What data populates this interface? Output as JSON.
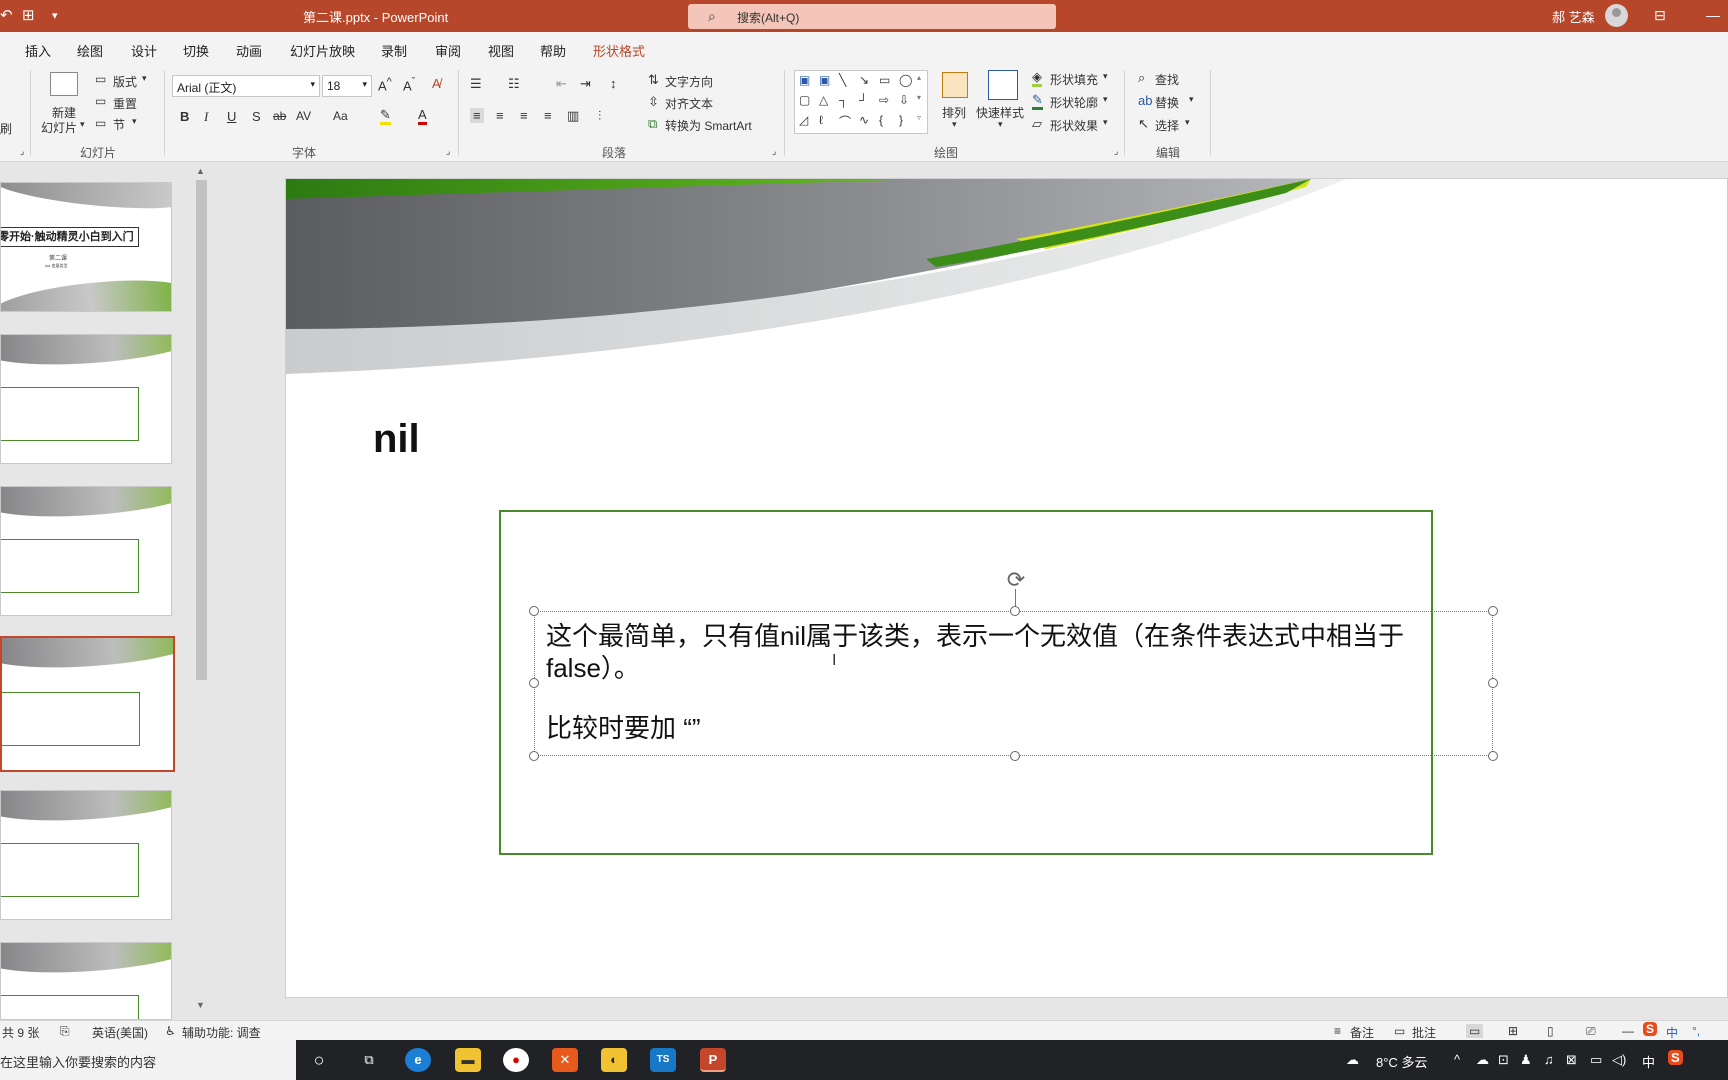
{
  "window": {
    "title": "第二课.pptx  -  PowerPoint",
    "search_placeholder": "搜索(Alt+Q)",
    "user_name": "郝 艺森"
  },
  "tabs": [
    "插入",
    "绘图",
    "设计",
    "切换",
    "动画",
    "幻灯片放映",
    "录制",
    "审阅",
    "视图",
    "帮助",
    "形状格式"
  ],
  "ribbon": {
    "clipboard_partial": "刷",
    "slides": {
      "new_slide_line1": "新建",
      "new_slide_line2": "幻灯片",
      "layout": "版式",
      "reset": "重置",
      "section": "节",
      "group_label": "幻灯片"
    },
    "font": {
      "font_name": "Arial (正文)",
      "font_size": "18",
      "group_label": "字体",
      "bold": "B",
      "italic": "I",
      "underline": "U",
      "shadow": "S",
      "strike": "ab",
      "spacing": "AV",
      "case": "Aa"
    },
    "paragraph": {
      "text_direction": "文字方向",
      "align_text": "对齐文本",
      "convert_smartart": "转换为 SmartArt",
      "group_label": "段落"
    },
    "drawing": {
      "arrange": "排列",
      "quick_styles": "快速样式",
      "shape_fill": "形状填充",
      "shape_outline": "形状轮廓",
      "shape_effects": "形状效果",
      "group_label": "绘图"
    },
    "editing": {
      "find": "查找",
      "replace": "替换",
      "select": "选择",
      "group_label": "编辑"
    }
  },
  "thumbnails": {
    "slide1_title": "零开始·触动精灵小白到入门",
    "slide1_sub": "第二课",
    "slide1_note": "lua 变量类型"
  },
  "slide": {
    "title": "nil",
    "body_line1": "这个最简单，只有值nil属于该类，表示一个无效值（在条件表达式中相当于",
    "body_line2": "false）。",
    "body_line3": "比较时要加 “”"
  },
  "status": {
    "slide_count": "共 9 张",
    "language": "英语(美国)",
    "accessibility": "辅助功能: 调查",
    "notes": "备注",
    "comments": "批注"
  },
  "taskbar": {
    "search_text": "在这里输入你要搜索的内容",
    "weather": "8°C  多云",
    "ime": "中",
    "app_ts": "TS"
  },
  "colors": {
    "accent": "#b7472a",
    "frame_green": "#4a8a2c"
  }
}
